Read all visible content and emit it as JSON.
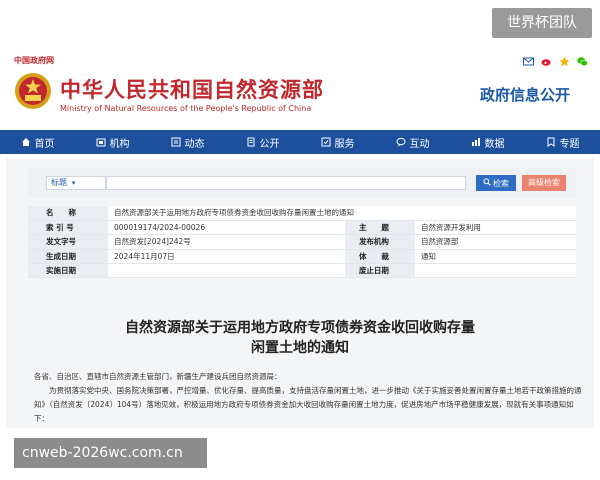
{
  "header": {
    "gov_link": "中国政府网",
    "brand_cn": "中华人民共和国自然资源部",
    "brand_en": "Ministry of Natural Resources of the People's Republic of China",
    "section_title": "政府信息公开",
    "share_icons": [
      "mail-icon",
      "weibo-icon",
      "qzone-icon",
      "wechat-icon"
    ],
    "brand_color": "#c0282d",
    "accent_color": "#1c5aa8"
  },
  "watermark": {
    "top": "世界杯团队",
    "bottom": "cnweb-2026wc.com.cn"
  },
  "nav": {
    "items": [
      {
        "label": "首页",
        "icon": "home-icon"
      },
      {
        "label": "机构",
        "icon": "org-icon"
      },
      {
        "label": "动态",
        "icon": "news-icon"
      },
      {
        "label": "公开",
        "icon": "open-icon"
      },
      {
        "label": "服务",
        "icon": "service-icon"
      },
      {
        "label": "互动",
        "icon": "chat-icon"
      },
      {
        "label": "数据",
        "icon": "data-icon"
      },
      {
        "label": "专题",
        "icon": "topic-icon"
      }
    ],
    "bg_color": "#1c4f9c"
  },
  "search": {
    "select_value": "标题",
    "placeholder": "",
    "button_label": "检索",
    "advanced_label": "高级检索"
  },
  "meta": {
    "name_label": "名　　称",
    "name_value": "自然资源部关于运用地方政府专项债券资金收回收购存量闲置土地的通知",
    "index_label": "索 引 号",
    "index_value": "000019174/2024-00026",
    "topic_label": "主　　题",
    "topic_value": "自然资源开发利用",
    "docno_label": "发文字号",
    "docno_value": "自然资发[2024]242号",
    "issuer_label": "发布机构",
    "issuer_value": "自然资源部",
    "date_label": "生成日期",
    "date_value": "2024年11月07日",
    "carrier_label": "体　　裁",
    "carrier_value": "通知",
    "impl_label": "实施日期",
    "impl_value": "",
    "abolish_label": "废止日期",
    "abolish_value": ""
  },
  "document": {
    "title_line1": "自然资源部关于运用地方政府专项债券资金收回收购存量",
    "title_line2": "闲置土地的通知",
    "salutation": "各省、自治区、直辖市自然资源主管部门，新疆生产建设兵团自然资源局：",
    "para1": "为贯彻落实党中央、国务院决策部署，严控增量、优化存量、提高质量，支持盘活存量闲置土地，进一步推动《关于实施妥善处置闲置存量土地若干政策措施的通知》（自然资发〔2024〕104号）落地见效，积极运用地方政府专项债券资金加大收回收购存量闲置土地力度，促进房地产市场平稳健康发展，现就有关事项通知如下："
  }
}
